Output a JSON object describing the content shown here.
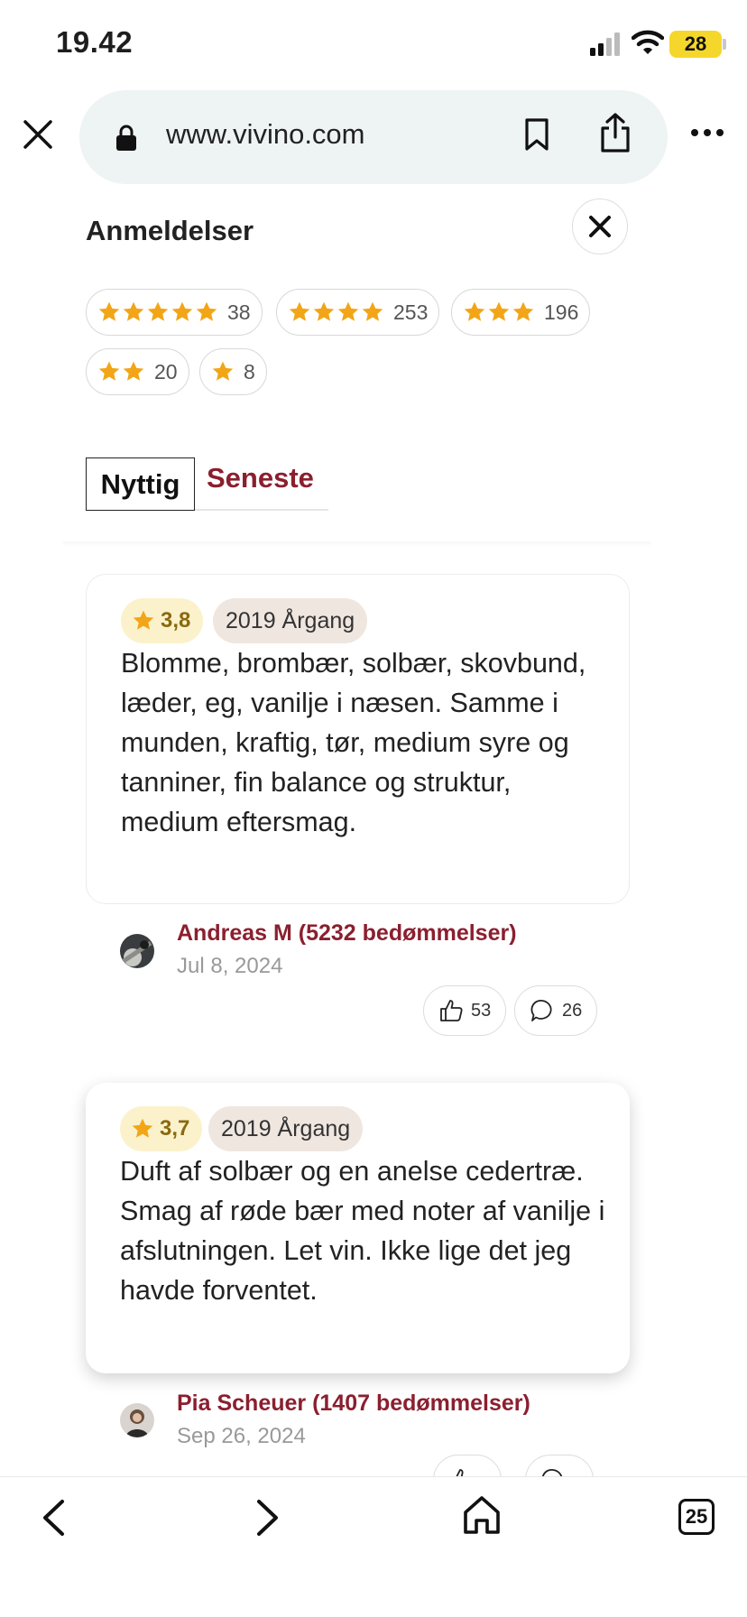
{
  "status_bar": {
    "time": "19.42",
    "battery": "28",
    "battery_color": "#f5d72b"
  },
  "browser": {
    "url": "www.vivino.com"
  },
  "reviews": {
    "title": "Anmeldelser",
    "rating_filters": [
      {
        "stars": 5,
        "count": "38"
      },
      {
        "stars": 4,
        "count": "253"
      },
      {
        "stars": 3,
        "count": "196"
      },
      {
        "stars": 2,
        "count": "20"
      },
      {
        "stars": 1,
        "count": "8"
      }
    ],
    "tabs": [
      {
        "label": "Nyttig",
        "active": true
      },
      {
        "label": "Seneste",
        "active": false
      }
    ],
    "items": [
      {
        "rating": "3,8",
        "vintage": "2019 Årgang",
        "text": "Blomme, brombær, solbær, skovbund, læder, eg, vanilje i næsen. Samme i munden, kraftig, tør, medium syre og tanniner, fin balance og struktur, medium eftersmag.",
        "author": "Andreas M (5232 bedømmelser)",
        "date": "Jul 8, 2024",
        "likes": "53",
        "comments": "26"
      },
      {
        "rating": "3,7",
        "vintage": "2019 Årgang",
        "text": "Duft af solbær og en anelse cedertræ. Smag af røde bær med noter af vanilje i afslutningen. Let vin. Ikke lige det jeg havde forventet.",
        "author": "Pia Scheuer (1407 bedømmelser)",
        "date": "Sep 26, 2024"
      }
    ]
  },
  "toolbar": {
    "tab_count": "25"
  },
  "colors": {
    "accent": "#8b1f2f",
    "star": "#f2a516",
    "rating_bg": "#fbf2cc",
    "vintage_bg": "#efe6e0"
  }
}
